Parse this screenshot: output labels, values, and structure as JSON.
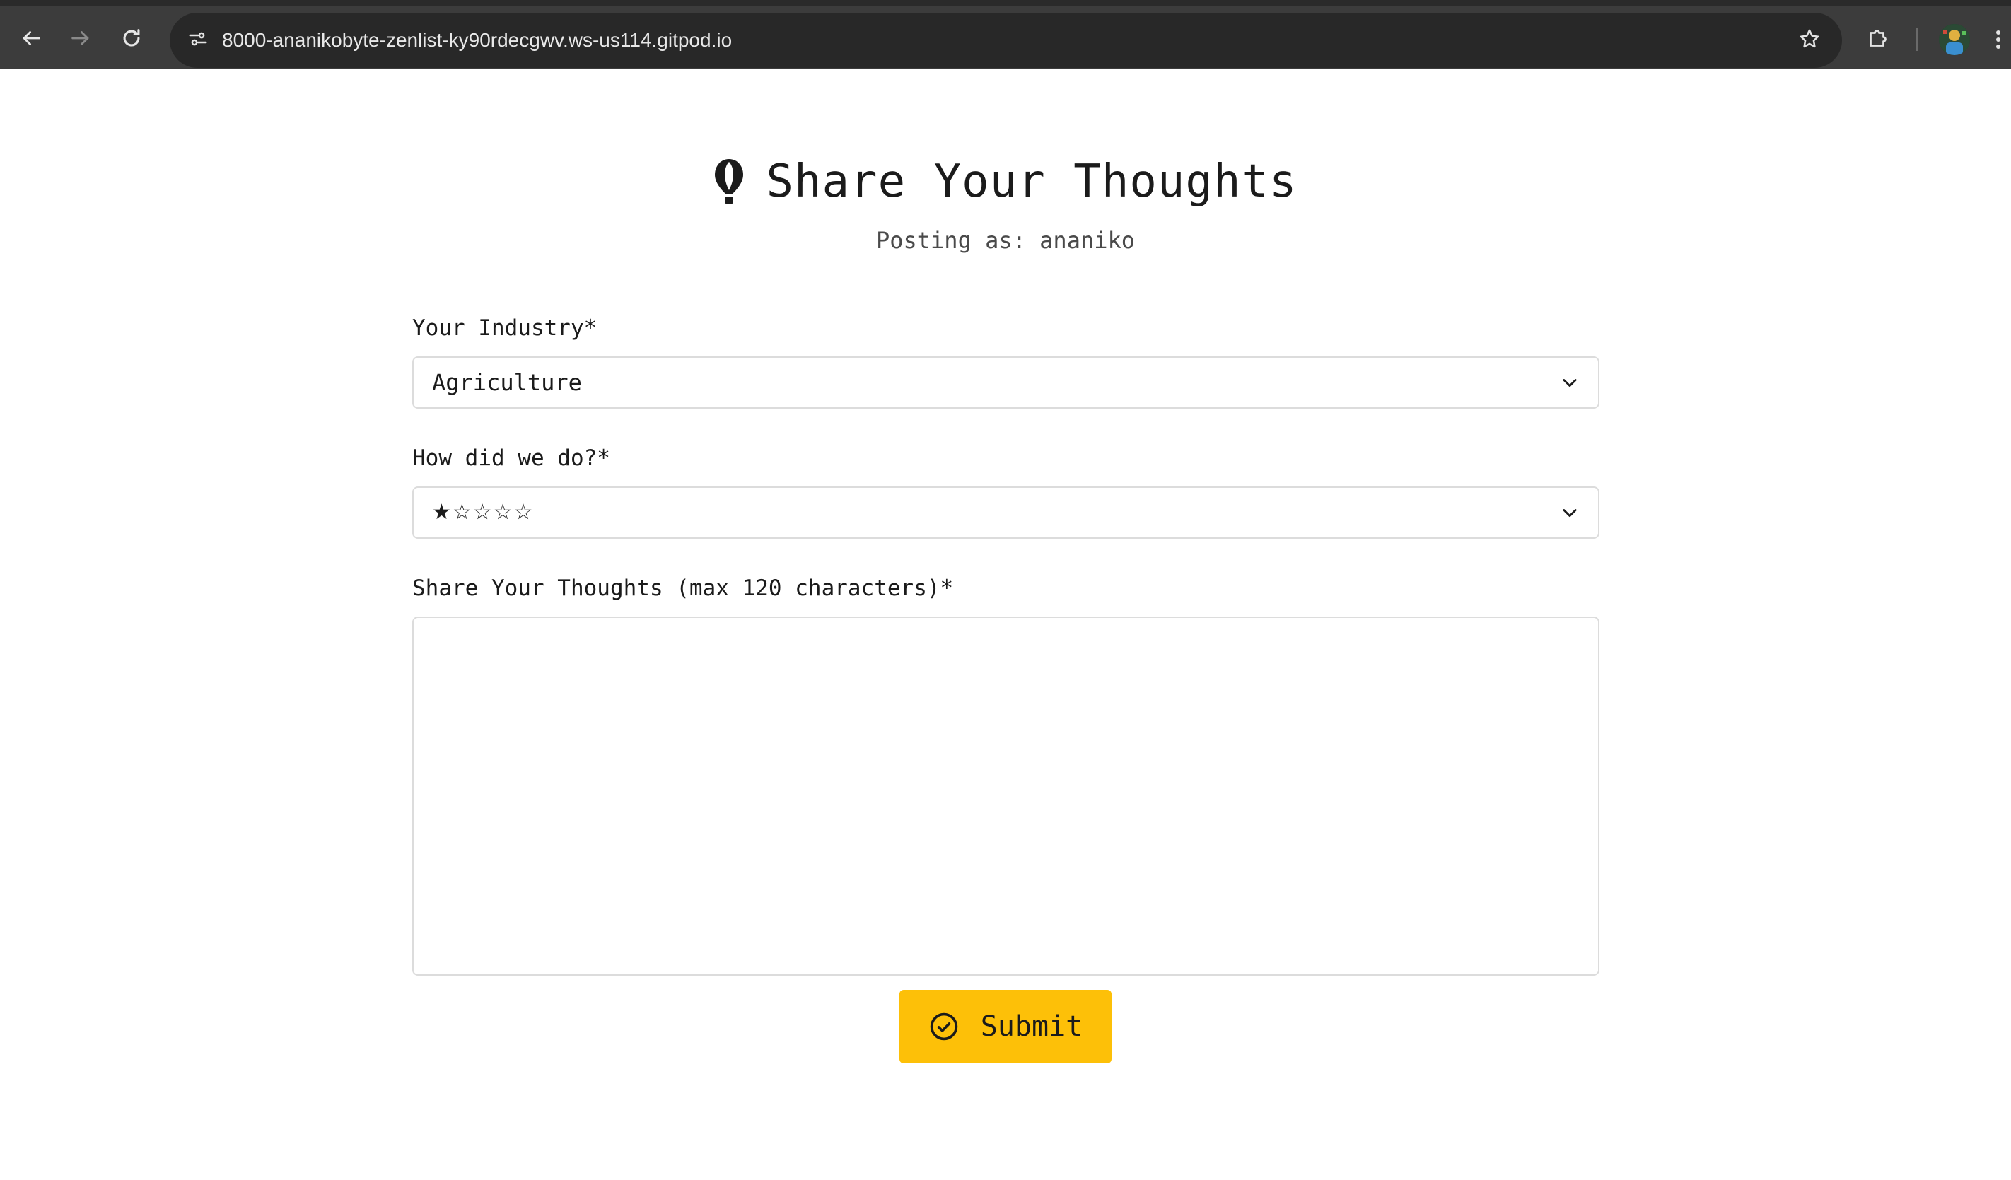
{
  "browser": {
    "url": "8000-ananikobyte-zenlist-ky90rdecgwv.ws-us114.gitpod.io",
    "icons": {
      "back": "arrow-left-icon",
      "forward": "arrow-right-icon",
      "reload": "reload-icon",
      "site_info": "tune-icon",
      "bookmark": "star-icon",
      "extensions": "puzzle-icon",
      "profile": "avatar",
      "menu": "kebab-menu-icon"
    }
  },
  "header": {
    "icon": "hot-air-balloon-icon",
    "title": "Share Your Thoughts",
    "posting_as": "Posting as: ananiko"
  },
  "form": {
    "industry": {
      "label": "Your Industry*",
      "selected": "Agriculture"
    },
    "rating": {
      "label": "How did we do?*",
      "selected": "★☆☆☆☆"
    },
    "thoughts": {
      "label": "Share Your Thoughts (max 120 characters)*",
      "value": ""
    },
    "submit": {
      "label": "Submit",
      "icon": "check-circle-icon"
    }
  },
  "colors": {
    "accent": "#fdc008",
    "chrome_bg": "#3c3c3c",
    "omnibox_bg": "#282828",
    "border": "#dcdcdc"
  }
}
